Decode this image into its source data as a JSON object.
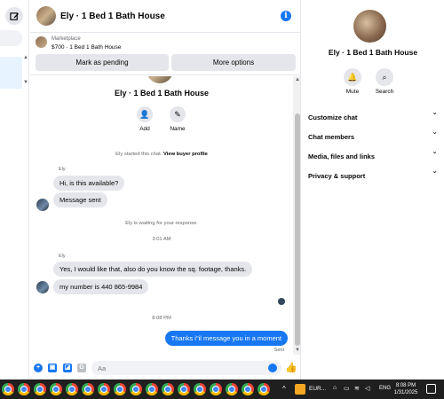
{
  "chat": {
    "header_title": "Ely · 1 Bed 1 Bath House",
    "marketplace_label": "Marketplace",
    "listing": "$700 · 1 Bed 1 Bath House",
    "mark_pending": "Mark as pending",
    "more_options": "More options",
    "intro_name": "Ely · 1 Bed 1 Bath House",
    "add_label": "Add",
    "name_label": "Name",
    "started_text": "Ely started this chat.",
    "view_profile": "View buyer profile",
    "sender_1": "Ely",
    "msg_1": "Hi, is this available?",
    "msg_2": "Message sent",
    "waiting": "Ely is waiting for your response.",
    "time_1": "3:01 AM",
    "sender_2": "Ely",
    "msg_3": "Yes, I would like that, also do you know the sq. footage, thanks.",
    "msg_4": "my number is 440 865-9984",
    "time_2": "8:08 PM",
    "msg_out": "Thanks i\"il message you in a moment",
    "sent_label": "Sent",
    "composer_placeholder": "Aa"
  },
  "right_panel": {
    "title": "Ely · 1 Bed 1 Bath House",
    "mute_label": "Mute",
    "search_label": "Search",
    "sections": [
      "Customize chat",
      "Chat members",
      "Media, files and links",
      "Privacy & support"
    ]
  },
  "taskbar": {
    "eur_label": "EUR...",
    "lang": "ENG",
    "time": "8:08 PM",
    "date": "1/31/2025"
  },
  "icons": {
    "compose": "compose-icon",
    "info": "info-icon",
    "like": "thumbs-up-icon",
    "emoji": "emoji-icon",
    "mute": "bell-icon",
    "search": "search-icon"
  },
  "colors": {
    "accent": "#1877f2",
    "bubble_in": "#e4e6eb",
    "taskbar": "#1f1f1f"
  }
}
